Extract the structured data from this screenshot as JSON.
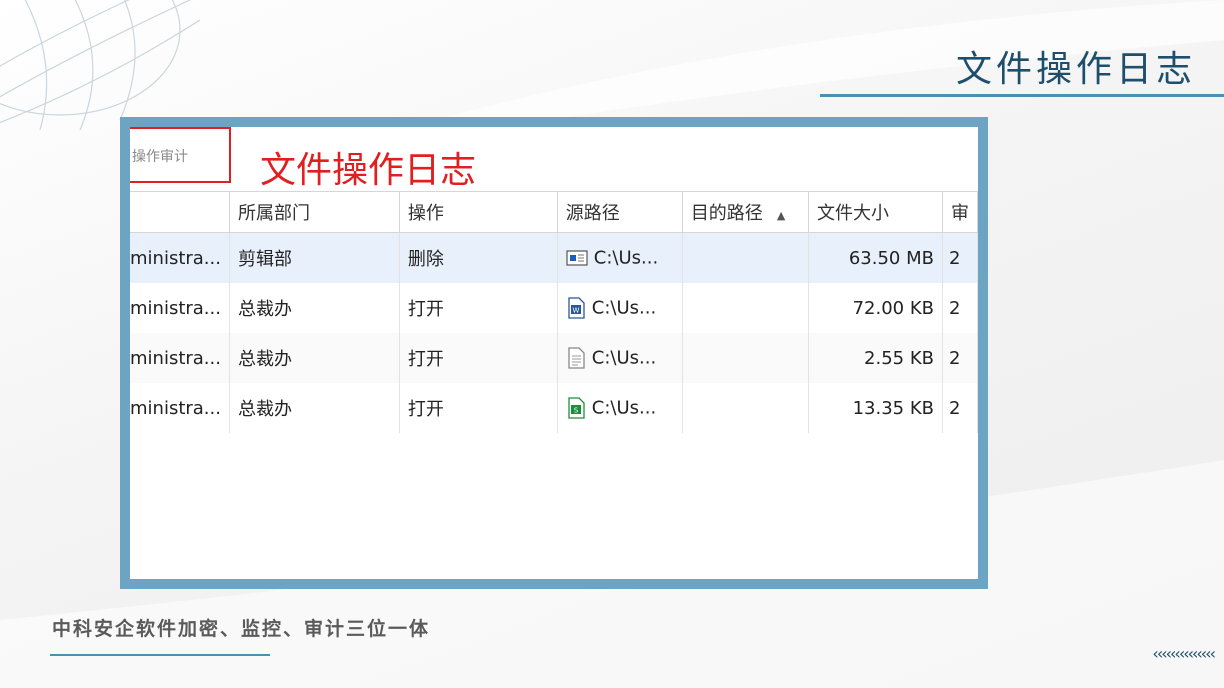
{
  "slide": {
    "title": "文件操作日志",
    "subtitle": "中科安企软件加密、监控、审计三位一体",
    "chevrons": "‹‹‹‹‹‹‹‹‹‹‹‹‹‹"
  },
  "screenshot": {
    "audit_tab_label": "操作审计",
    "heading": "文件操作日志",
    "columns": [
      "",
      "所属部门",
      "操作",
      "源路径",
      "目的路径",
      "文件大小",
      "审"
    ],
    "sort_indicator": "▲",
    "rows": [
      {
        "user": "ministra...",
        "department": "剪辑部",
        "action": "删除",
        "file_icon": "video-file-icon",
        "source": "C:\\Us...",
        "destination": "",
        "size": "63.50 MB",
        "extra": "2"
      },
      {
        "user": "ministra...",
        "department": "总裁办",
        "action": "打开",
        "file_icon": "word-file-icon",
        "source": "C:\\Us...",
        "destination": "",
        "size": "72.00 KB",
        "extra": "2"
      },
      {
        "user": "ministra...",
        "department": "总裁办",
        "action": "打开",
        "file_icon": "text-file-icon",
        "source": "C:\\Us...",
        "destination": "",
        "size": "2.55 KB",
        "extra": "2"
      },
      {
        "user": "ministra...",
        "department": "总裁办",
        "action": "打开",
        "file_icon": "spreadsheet-file-icon",
        "source": "C:\\Us...",
        "destination": "",
        "size": "13.35 KB",
        "extra": "2"
      }
    ]
  },
  "colors": {
    "accent_blue": "#4a90b0",
    "frame_blue": "#6da3c3",
    "title_navy": "#1d4e6b",
    "highlight_red": "#e02020",
    "selected_row": "#e8f1fb"
  }
}
